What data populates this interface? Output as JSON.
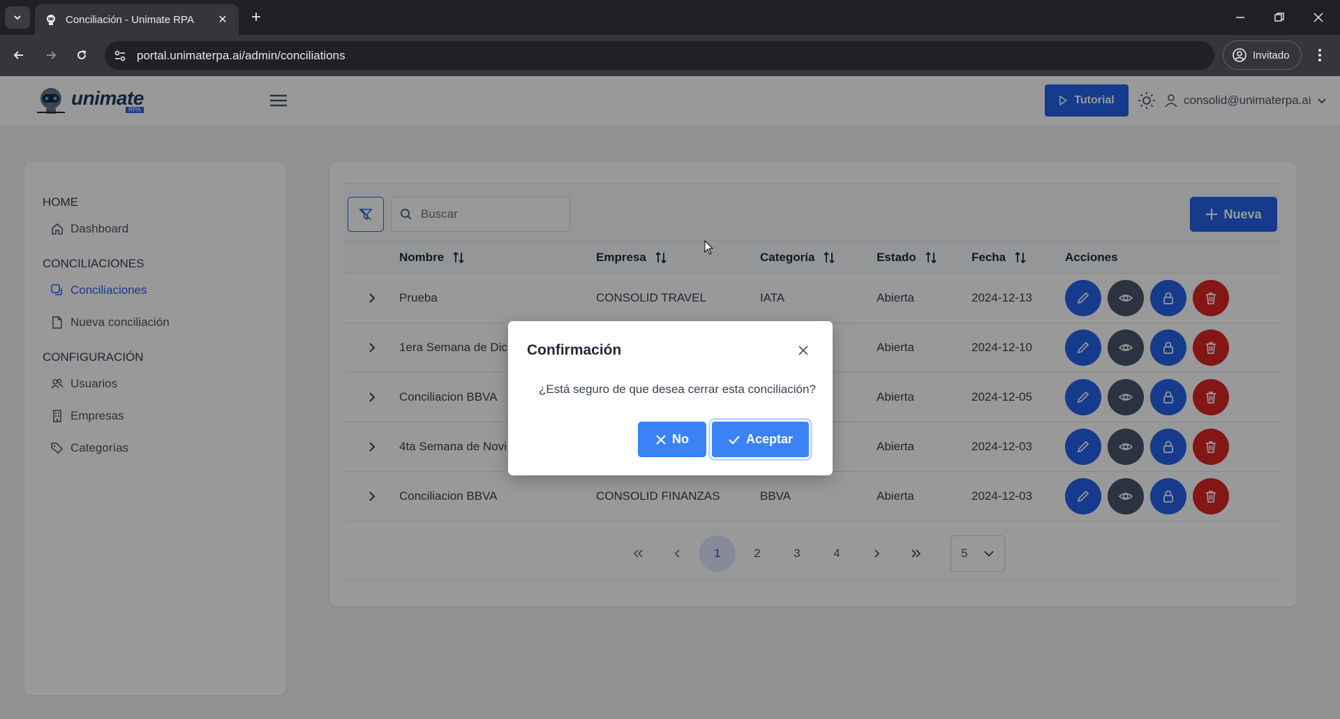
{
  "browser": {
    "tab_title": "Conciliación - Unimate RPA",
    "url": "portal.unimaterpa.ai/admin/conciliations",
    "profile_label": "Invitado"
  },
  "header": {
    "logo_text": "unimate",
    "logo_sub": "RPA",
    "tutorial_label": "Tutorial",
    "user_email": "consolid@unimaterpa.ai"
  },
  "sidebar": {
    "sections": [
      {
        "title": "HOME",
        "items": [
          {
            "label": "Dashboard",
            "icon": "home-icon",
            "active": false
          }
        ]
      },
      {
        "title": "CONCILIACIONES",
        "items": [
          {
            "label": "Conciliaciones",
            "icon": "copy-icon",
            "active": true
          },
          {
            "label": "Nueva conciliación",
            "icon": "file-icon",
            "active": false
          }
        ]
      },
      {
        "title": "CONFIGURACIÓN",
        "items": [
          {
            "label": "Usuarios",
            "icon": "users-icon",
            "active": false
          },
          {
            "label": "Empresas",
            "icon": "building-icon",
            "active": false
          },
          {
            "label": "Categorías",
            "icon": "tags-icon",
            "active": false
          }
        ]
      }
    ]
  },
  "toolbar": {
    "search_placeholder": "Buscar",
    "new_label": "Nueva"
  },
  "table": {
    "columns": [
      "Nombre",
      "Empresa",
      "Categoría",
      "Estado",
      "Fecha",
      "Acciones"
    ],
    "rows": [
      {
        "nombre": "Prueba",
        "empresa": "CONSOLID TRAVEL",
        "categoria": "IATA",
        "estado": "Abierta",
        "fecha": "2024-12-13"
      },
      {
        "nombre": "1era Semana de Dic",
        "empresa": "",
        "categoria": "",
        "estado": "Abierta",
        "fecha": "2024-12-10"
      },
      {
        "nombre": "Conciliacion BBVA",
        "empresa": "",
        "categoria": "",
        "estado": "Abierta",
        "fecha": "2024-12-05"
      },
      {
        "nombre": "4ta Semana de Novi",
        "empresa": "",
        "categoria": "",
        "estado": "Abierta",
        "fecha": "2024-12-03"
      },
      {
        "nombre": "Conciliacion BBVA",
        "empresa": "CONSOLID FINANZAS",
        "categoria": "BBVA",
        "estado": "Abierta",
        "fecha": "2024-12-03"
      }
    ]
  },
  "pagination": {
    "pages": [
      "1",
      "2",
      "3",
      "4"
    ],
    "current": "1",
    "page_size": "5"
  },
  "dialog": {
    "title": "Confirmación",
    "message": "¿Está seguro de que desea cerrar esta conciliación?",
    "no_label": "No",
    "yes_label": "Aceptar"
  },
  "colors": {
    "primary": "#2563eb",
    "danger": "#dc2626",
    "secondary": "#475569"
  }
}
